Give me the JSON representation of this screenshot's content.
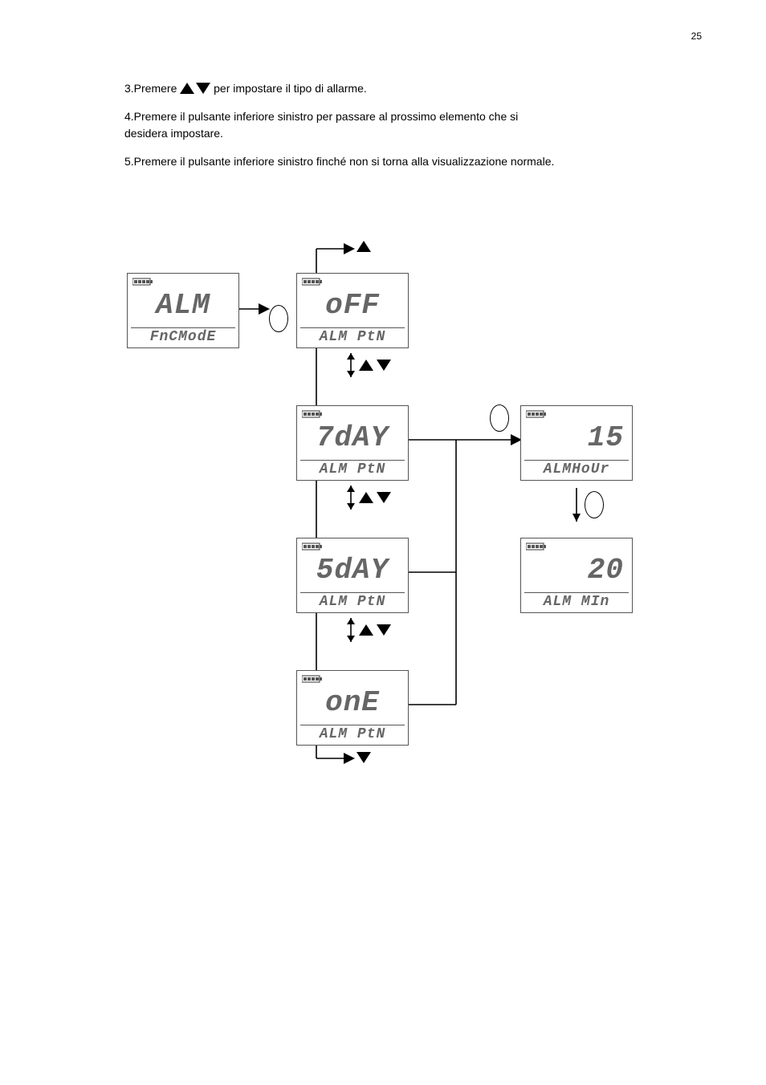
{
  "page_number": "25",
  "text": {
    "p1_part1": "3.Premere ",
    "p1_part2": " per impostare il tipo di allarme.",
    "p2": "4.Premere il pulsante inferiore sinistro per passare al prossimo elemento che si\ndesidera impostare.",
    "p3": "5.Premere il pulsante inferiore sinistro finché non si torna alla visualizzazione normale."
  },
  "boxes": {
    "fnc": {
      "main": "ALM",
      "sub": "FnCModE"
    },
    "off": {
      "main": "oFF",
      "sub": "ALM  PtN"
    },
    "d7": {
      "main": "7dAY",
      "sub": "ALM  PtN"
    },
    "d5": {
      "main": "5dAY",
      "sub": "ALM  PtN"
    },
    "one": {
      "main": "onE",
      "sub": "ALM  PtN"
    },
    "hour": {
      "main": "15",
      "sub": "ALMHoUr"
    },
    "min": {
      "main": "20",
      "sub": "ALM  MIn"
    }
  }
}
